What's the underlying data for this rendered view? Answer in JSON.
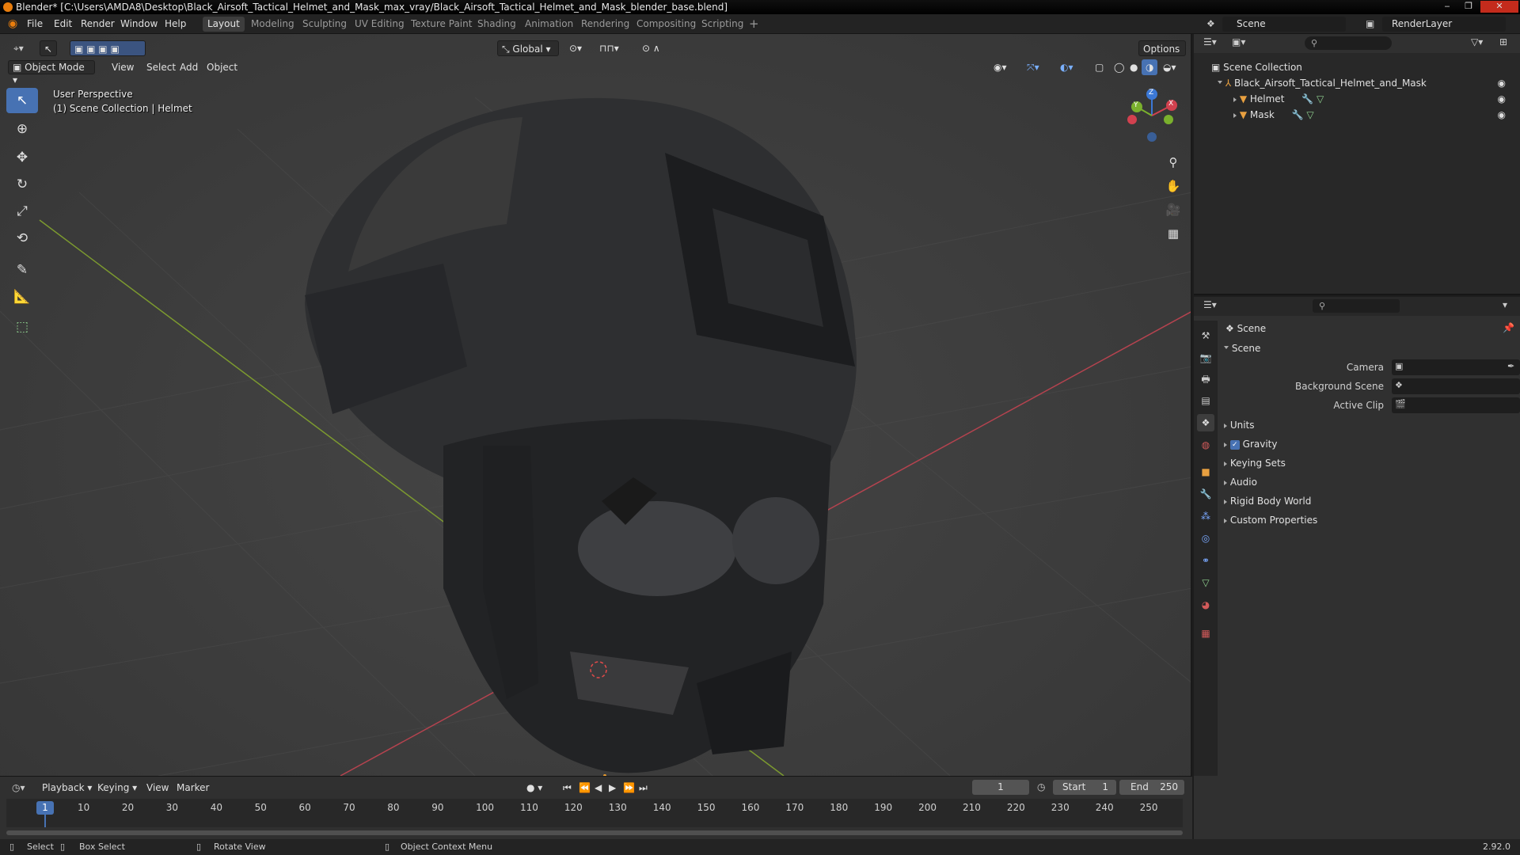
{
  "title_bar": {
    "text": "Blender* [C:\\Users\\AMDA8\\Desktop\\Black_Airsoft_Tactical_Helmet_and_Mask_max_vray/Black_Airsoft_Tactical_Helmet_and_Mask_blender_base.blend]",
    "minimize": "‒",
    "maximize": "❐",
    "close": "✕"
  },
  "menu": [
    "File",
    "Edit",
    "Render",
    "Window",
    "Help"
  ],
  "workspaces": [
    "Layout",
    "Modeling",
    "Sculpting",
    "UV Editing",
    "Texture Paint",
    "Shading",
    "Animation",
    "Rendering",
    "Compositing",
    "Scripting"
  ],
  "active_workspace": "Layout",
  "scene_selector": "Scene",
  "render_layer": "RenderLayer",
  "viewport": {
    "transform_orientation": "Global",
    "options_label": "Options",
    "mode": "Object Mode",
    "menus": [
      "View",
      "Select",
      "Add",
      "Object"
    ],
    "perspective_text": "User Perspective",
    "collection_text": "(1) Scene Collection | Helmet",
    "gizmo_axes": {
      "x": "X",
      "y": "Y",
      "z": "Z"
    },
    "colors": {
      "x_axis": "#d2414f",
      "y_axis": "#7ab02d",
      "z_axis": "#3b78d6",
      "accent": "#4772b3"
    }
  },
  "outliner": {
    "root": "Scene Collection",
    "collection": "Black_Airsoft_Tactical_Helmet_and_Mask",
    "objects": [
      "Helmet",
      "Mask"
    ]
  },
  "properties": {
    "header": "Scene",
    "panel": "Scene",
    "fields": {
      "camera_label": "Camera",
      "background_scene_label": "Background Scene",
      "active_clip_label": "Active Clip"
    },
    "subpanels": {
      "units": "Units",
      "gravity": "Gravity",
      "keying_sets": "Keying Sets",
      "audio": "Audio",
      "rigid_body_world": "Rigid Body World",
      "custom_properties": "Custom Properties"
    },
    "gravity_checked": true
  },
  "timeline": {
    "menus": [
      "Playback",
      "Keying",
      "View",
      "Marker"
    ],
    "current_frame": "1",
    "start_label": "Start",
    "start_value": "1",
    "end_label": "End",
    "end_value": "250",
    "ruler": [
      "10",
      "20",
      "30",
      "40",
      "50",
      "60",
      "70",
      "80",
      "90",
      "100",
      "110",
      "120",
      "130",
      "140",
      "150",
      "160",
      "170",
      "180",
      "190",
      "200",
      "210",
      "220",
      "230",
      "240",
      "250"
    ],
    "cursor_frame": "1"
  },
  "status_bar": {
    "select": "Select",
    "box_select": "Box Select",
    "rotate_view": "Rotate View",
    "context_menu": "Object Context Menu",
    "version": "2.92.0"
  }
}
